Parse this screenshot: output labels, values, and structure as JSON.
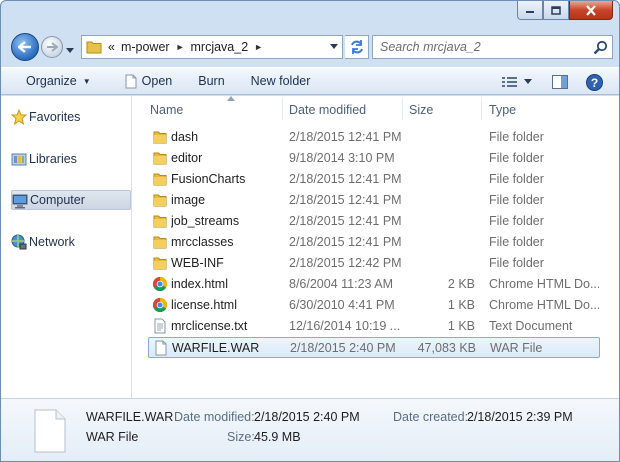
{
  "window": {
    "caption": {
      "minimize_icon": "minimize-icon",
      "maximize_icon": "maximize-icon",
      "close_icon": "close-icon"
    }
  },
  "address": {
    "overflow": "«",
    "segments": [
      "m-power",
      "mrcjava_2"
    ],
    "separator": "►"
  },
  "search": {
    "placeholder": "Search mrcjava_2"
  },
  "toolbar": {
    "organize": "Organize",
    "open": "Open",
    "burn": "Burn",
    "new_folder": "New folder"
  },
  "nav": {
    "items": [
      {
        "label": "Favorites",
        "icon": "star-icon"
      },
      {
        "label": "Libraries",
        "icon": "library-icon"
      },
      {
        "label": "Computer",
        "icon": "computer-icon",
        "selected": true
      },
      {
        "label": "Network",
        "icon": "network-icon"
      }
    ]
  },
  "columns": {
    "name": "Name",
    "date": "Date modified",
    "size": "Size",
    "type": "Type"
  },
  "files": [
    {
      "name": "dash",
      "date": "2/18/2015 12:41 PM",
      "size": "",
      "type": "File folder",
      "icon": "folder-icon"
    },
    {
      "name": "editor",
      "date": "9/18/2014 3:10 PM",
      "size": "",
      "type": "File folder",
      "icon": "folder-icon"
    },
    {
      "name": "FusionCharts",
      "date": "2/18/2015 12:41 PM",
      "size": "",
      "type": "File folder",
      "icon": "folder-icon"
    },
    {
      "name": "image",
      "date": "2/18/2015 12:41 PM",
      "size": "",
      "type": "File folder",
      "icon": "folder-icon"
    },
    {
      "name": "job_streams",
      "date": "2/18/2015 12:41 PM",
      "size": "",
      "type": "File folder",
      "icon": "folder-icon"
    },
    {
      "name": "mrcclasses",
      "date": "2/18/2015 12:41 PM",
      "size": "",
      "type": "File folder",
      "icon": "folder-icon"
    },
    {
      "name": "WEB-INF",
      "date": "2/18/2015 12:42 PM",
      "size": "",
      "type": "File folder",
      "icon": "folder-icon"
    },
    {
      "name": "index.html",
      "date": "8/6/2004 11:23 AM",
      "size": "2 KB",
      "type": "Chrome HTML Do...",
      "icon": "chrome-icon"
    },
    {
      "name": "license.html",
      "date": "6/30/2010 4:41 PM",
      "size": "1 KB",
      "type": "Chrome HTML Do...",
      "icon": "chrome-icon"
    },
    {
      "name": "mrclicense.txt",
      "date": "12/16/2014 10:19 ...",
      "size": "1 KB",
      "type": "Text Document",
      "icon": "text-file-icon"
    },
    {
      "name": "WARFILE.WAR",
      "date": "2/18/2015 2:40 PM",
      "size": "47,083 KB",
      "type": "WAR File",
      "icon": "blank-file-icon",
      "selected": true
    }
  ],
  "details": {
    "name": "WARFILE.WAR",
    "type": "WAR File",
    "modified_label": "Date modified:",
    "modified_value": "2/18/2015 2:40 PM",
    "created_label": "Date created:",
    "created_value": "2/18/2015 2:39 PM",
    "size_label": "Size:",
    "size_value": "45.9 MB"
  }
}
